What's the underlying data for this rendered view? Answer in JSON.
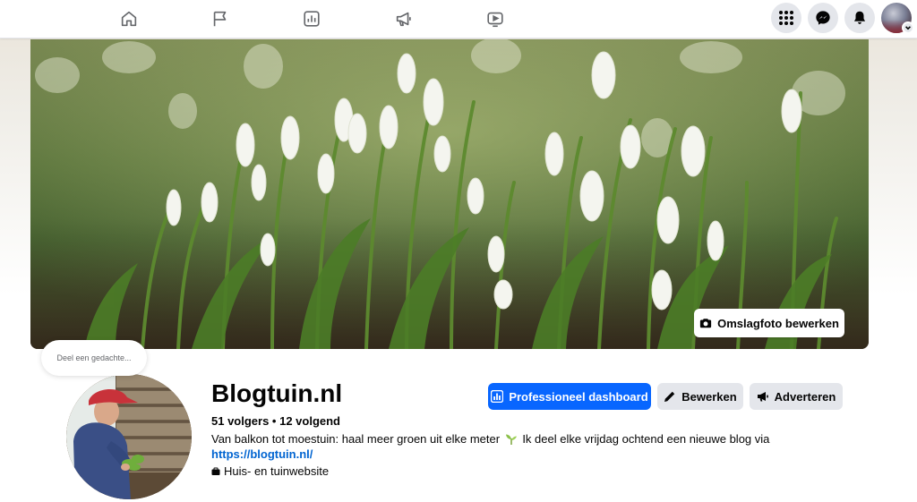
{
  "nav": {
    "tabs": [
      {
        "name": "home",
        "icon": "home-icon"
      },
      {
        "name": "flag",
        "icon": "flag-icon"
      },
      {
        "name": "insights",
        "icon": "bar-chart-icon"
      },
      {
        "name": "ads",
        "icon": "megaphone-icon"
      },
      {
        "name": "video",
        "icon": "video-play-icon"
      }
    ],
    "right_icons": [
      "apps-grid-icon",
      "messenger-icon",
      "bell-icon",
      "account-avatar"
    ]
  },
  "cover": {
    "edit_button_label": "Omslagfoto bewerken",
    "edit_button_icon": "camera-icon"
  },
  "note": {
    "placeholder": "Deel een gedachte..."
  },
  "profile": {
    "name": "Blogtuin.nl",
    "followers_line": "51 volgers • 12 volgend",
    "bio_text": "Van balkon tot moestuin: haal meer groen uit elke meter",
    "bio_text_2": "Ik deel elke vrijdag ochtend een nieuwe blog via",
    "bio_link": "https://blogtuin.nl/",
    "bio_emoji": "sprout-icon",
    "category_icon": "briefcase-icon",
    "category": "Huis- en tuinwebsite"
  },
  "actions": {
    "dashboard_label": "Professioneel dashboard",
    "edit_label": "Bewerken",
    "advertise_label": "Adverteren"
  },
  "colors": {
    "primary": "#0866ff",
    "link": "#0064d1",
    "button_grey": "#e4e6eb",
    "text": "#050505",
    "secondary_text": "#65676b"
  }
}
